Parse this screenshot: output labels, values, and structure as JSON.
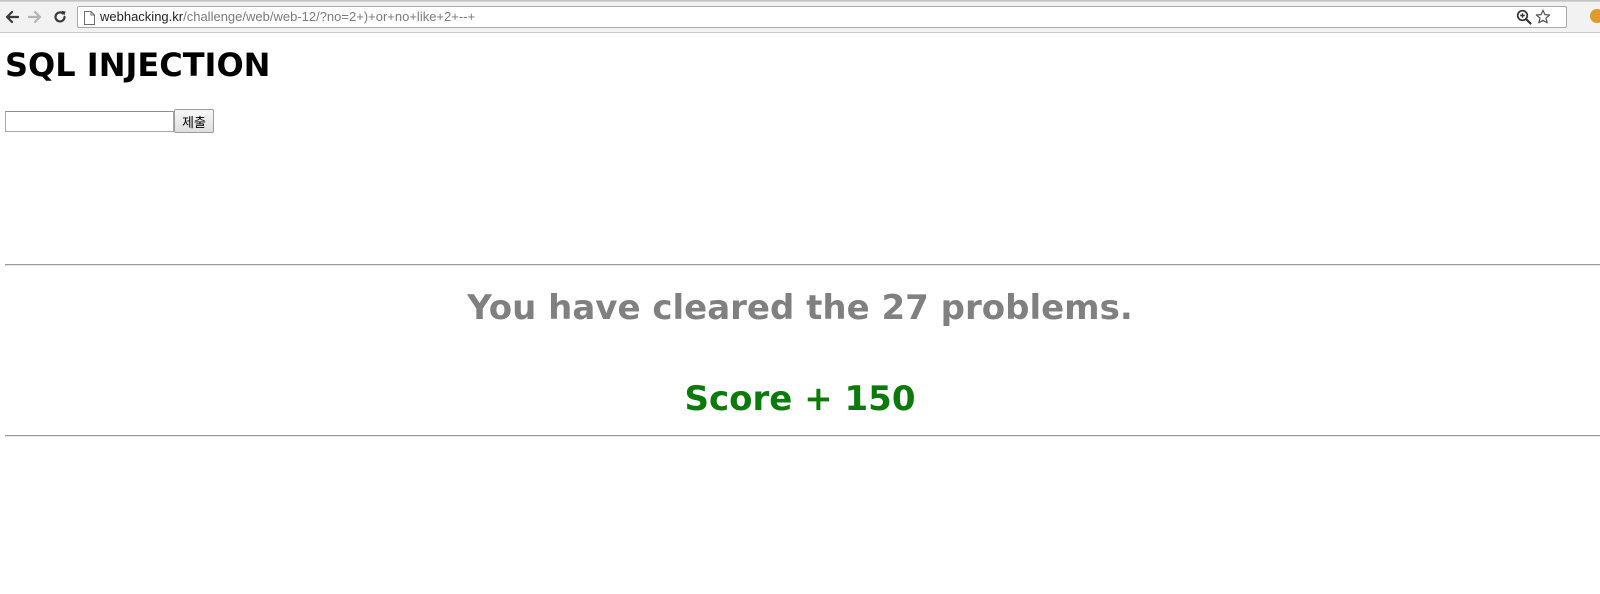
{
  "browser": {
    "url_host": "webhacking.kr",
    "url_path": "/challenge/web/web-12/?no=2+)+or+no+like+2+--+"
  },
  "page": {
    "heading": "SQL INJECTION",
    "input_value": "",
    "submit_label": "제출",
    "cleared_message": "You have cleared the 27 problems.",
    "score_message": "Score + 150"
  },
  "colors": {
    "cleared_text": "#808080",
    "score_text": "#0b7a0b"
  }
}
